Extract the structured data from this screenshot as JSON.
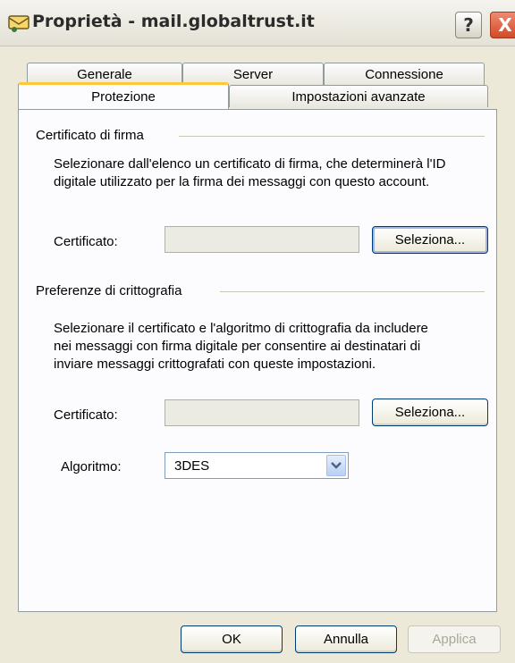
{
  "window": {
    "title": "Proprietà - mail.globaltrust.it"
  },
  "titlebar": {
    "help_label": "?",
    "close_label": "X"
  },
  "tabs": [
    {
      "label": "Generale"
    },
    {
      "label": "Server"
    },
    {
      "label": "Connessione"
    },
    {
      "label": "Protezione",
      "active": true
    },
    {
      "label": "Impostazioni avanzate"
    }
  ],
  "signing": {
    "group_label": "Certificato di firma",
    "description_line1": "Selezionare dall'elenco un certificato di firma, che determinerà l'ID",
    "description_line2": "digitale utilizzato per la firma dei messaggi con questo account.",
    "cert_label": "Certificato:",
    "cert_value": "",
    "select_button": "Seleziona..."
  },
  "encryption": {
    "group_label": "Preferenze di crittografia",
    "description_line1": "Selezionare il certificato e l'algoritmo di crittografia da includere",
    "description_line2": "nei messaggi con firma digitale per consentire ai destinatari di",
    "description_line3": "inviare messaggi crittografati con queste impostazioni.",
    "cert_label": "Certificato:",
    "cert_value": "",
    "select_button": "Seleziona...",
    "algorithm_label": "Algoritmo:",
    "algorithm_value": "3DES"
  },
  "footer": {
    "ok": "OK",
    "cancel": "Annulla",
    "apply": "Applica"
  },
  "colors": {
    "active_tab_accent": "#ffc83c",
    "close_button": "#d24a27",
    "dialog_bg": "#ece9d8"
  }
}
